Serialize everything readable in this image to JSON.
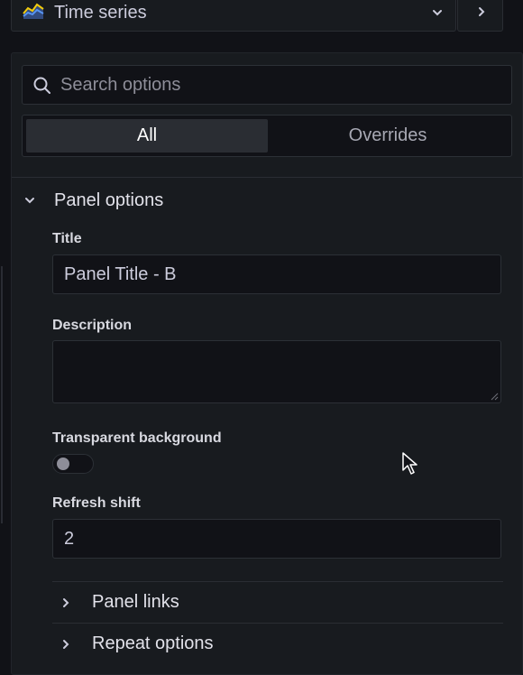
{
  "header": {
    "visualization_label": "Time series",
    "viz_icon": "time-series-icon",
    "dropdown_icon": "chevron-down-icon",
    "collapse_icon": "chevron-right-icon"
  },
  "search": {
    "placeholder": "Search options",
    "value": ""
  },
  "tabs": [
    {
      "label": "All",
      "active": true
    },
    {
      "label": "Overrides",
      "active": false
    }
  ],
  "panel_options": {
    "title": "Panel options",
    "expanded": true,
    "fields": {
      "title_label": "Title",
      "title_value": "Panel Title - B",
      "description_label": "Description",
      "description_value": "",
      "transparent_label": "Transparent background",
      "transparent_on": false,
      "refresh_label": "Refresh shift",
      "refresh_value": "2"
    }
  },
  "collapsed_sections": [
    {
      "label": "Panel links"
    },
    {
      "label": "Repeat options"
    }
  ],
  "colors": {
    "background": "#111217",
    "panel": "#181b1f",
    "border": "#2c3036",
    "text": "#ccccdc",
    "active_tab": "#2a2d33"
  }
}
